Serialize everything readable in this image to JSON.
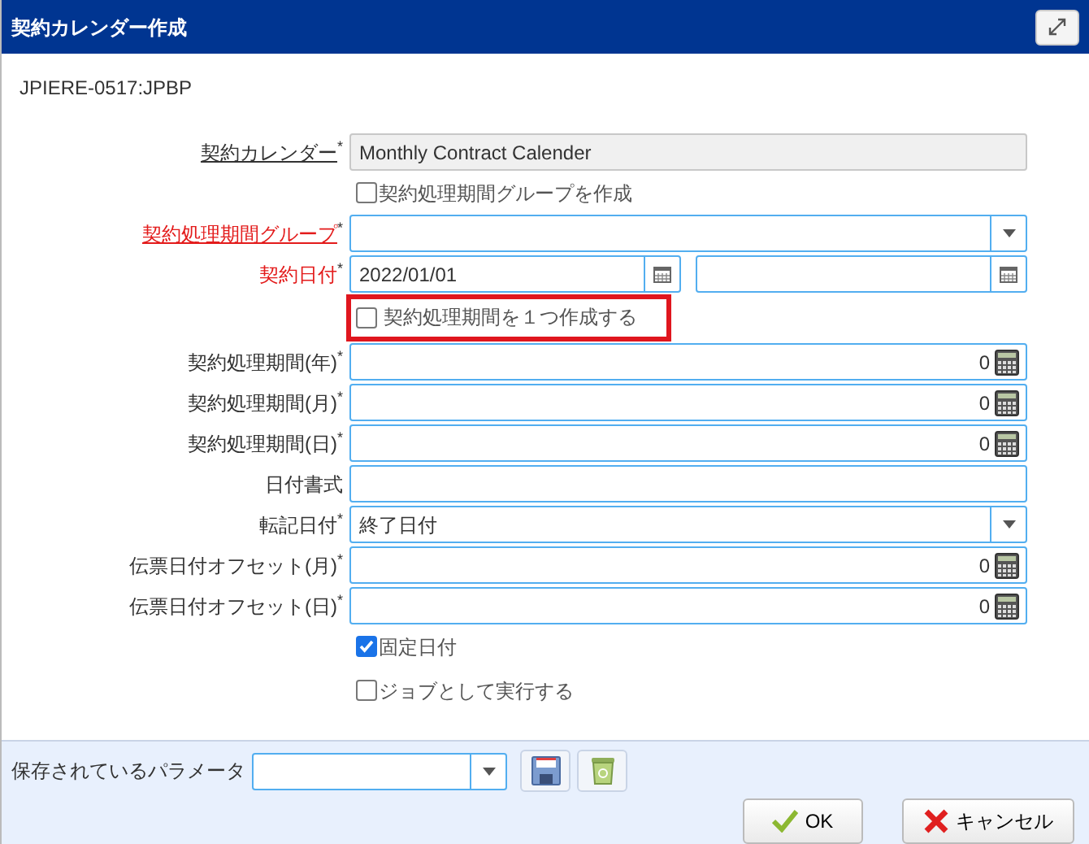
{
  "window": {
    "title": "契約カレンダー作成"
  },
  "process_code": "JPIERE-0517:JPBP",
  "rows": [
    {
      "kind": "text",
      "label": "契約カレンダー",
      "mark": "*",
      "link": true,
      "error": false,
      "value": "Monthly Contract Calender",
      "disabled": true
    },
    {
      "kind": "checkbox",
      "text": "契約処理期間グループを作成",
      "checked": false
    },
    {
      "kind": "select",
      "label": "契約処理期間グループ",
      "mark": "*",
      "link": true,
      "error": true
    },
    {
      "kind": "date-pair",
      "label": "契約日付",
      "mark": "*",
      "link": false,
      "error": true,
      "value": "2022/01/01"
    },
    {
      "kind": "checkbox",
      "text": "契約処理期間を１つ作成する",
      "checked": false,
      "highlight": true
    },
    {
      "kind": "number",
      "label": "契約処理期間(年)",
      "mark": "*",
      "link": false,
      "error": false,
      "value": "0"
    },
    {
      "kind": "number",
      "label": "契約処理期間(月)",
      "mark": "*",
      "link": false,
      "error": false,
      "value": "0"
    },
    {
      "kind": "number",
      "label": "契約処理期間(日)",
      "mark": "*",
      "link": false,
      "error": false,
      "value": "0"
    },
    {
      "kind": "text",
      "label": "日付書式",
      "link": false,
      "error": false,
      "disabled": false
    },
    {
      "kind": "select",
      "label": "転記日付",
      "mark": "*",
      "link": false,
      "error": false,
      "value": "終了日付"
    },
    {
      "kind": "number",
      "label": "伝票日付オフセット(月)",
      "mark": "*",
      "link": false,
      "error": false,
      "value": "0"
    },
    {
      "kind": "number",
      "label": "伝票日付オフセット(日)",
      "mark": "*",
      "link": false,
      "error": false,
      "value": "0"
    },
    {
      "kind": "checkbox",
      "text": "固定日付",
      "checked": true
    },
    {
      "kind": "checkbox",
      "text": "ジョブとして実行する",
      "checked": false
    }
  ],
  "footer": {
    "saved_parameters_label": "保存されているパラメータ",
    "buttons": [
      {
        "kind": "ok",
        "label": "OK"
      },
      {
        "kind": "cancel",
        "label": "キャンセル"
      }
    ]
  }
}
